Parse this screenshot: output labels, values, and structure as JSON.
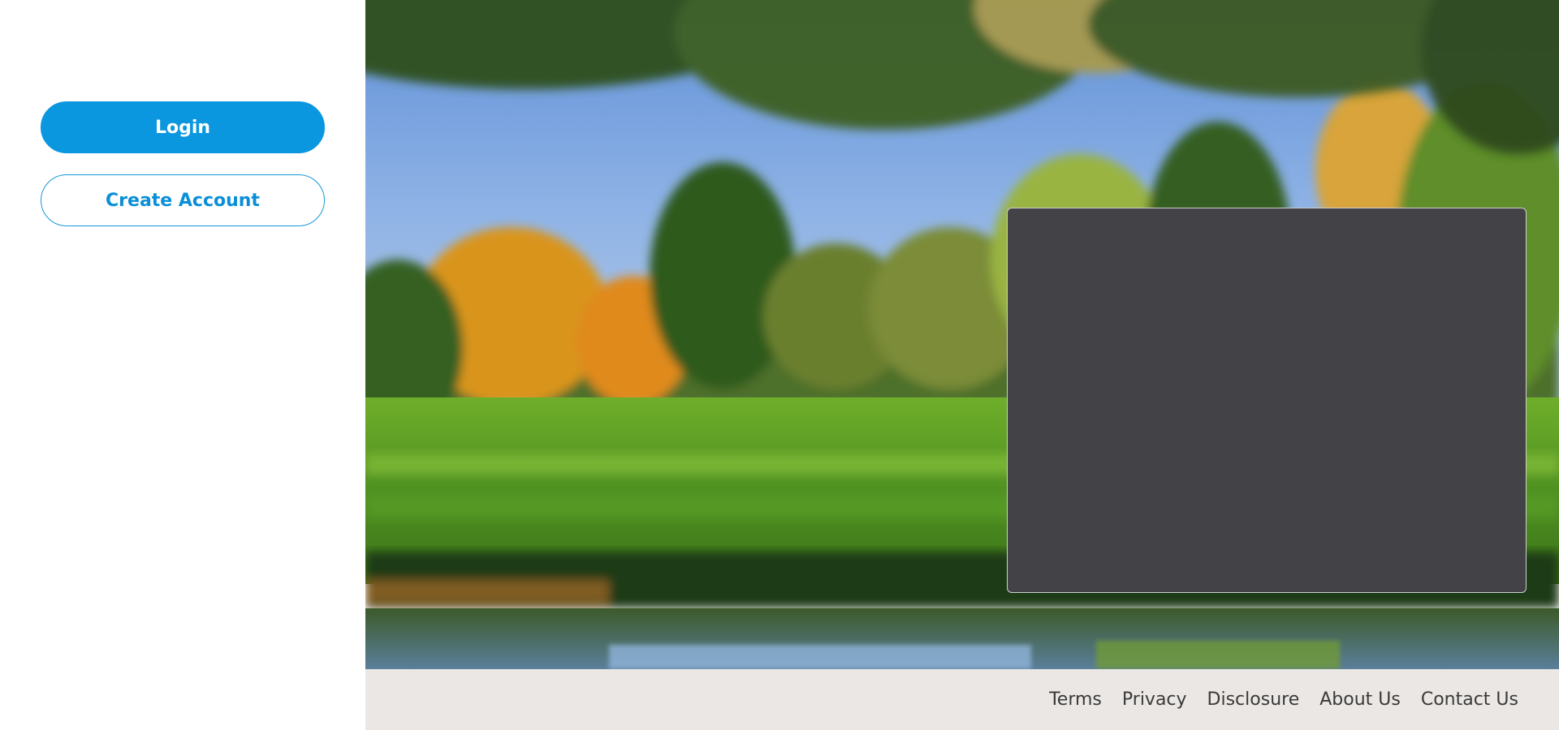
{
  "sidebar": {
    "login_label": "Login",
    "create_account_label": "Create Account"
  },
  "footer": {
    "links": [
      "Terms",
      "Privacy",
      "Disclosure",
      "About Us",
      "Contact Us"
    ]
  },
  "colors": {
    "primary": "#0a97e0",
    "panel": "#434247",
    "footer_bg": "#ebe7e4"
  }
}
